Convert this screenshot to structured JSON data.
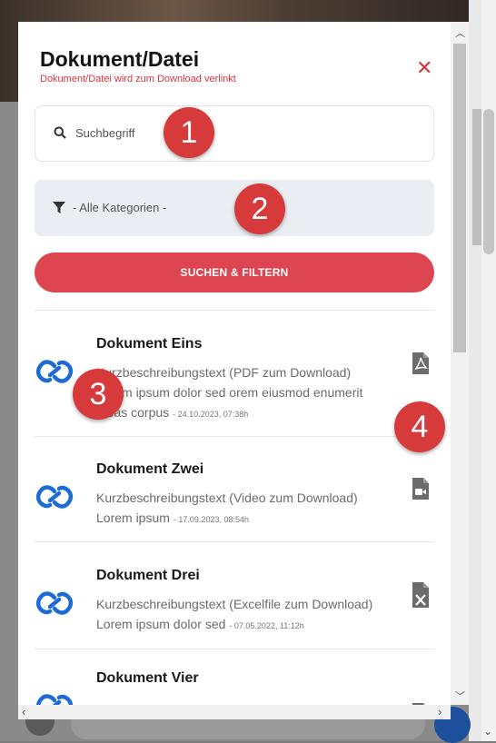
{
  "dialog": {
    "title": "Dokument/Datei",
    "subtitle": "Dokument/Datei wird zum Download verlinkt",
    "close_glyph": "✕"
  },
  "search": {
    "placeholder": "Suchbegriff",
    "icon": "search-icon"
  },
  "filter": {
    "label": "- Alle Kategorien -",
    "icon": "filter-icon"
  },
  "submit": {
    "label": "SUCHEN & FILTERN"
  },
  "colors": {
    "accent": "#dd4551",
    "link": "#1f6bd6",
    "badge": "#d73a3a",
    "filter_bg": "#eaedf2"
  },
  "items": [
    {
      "name": "Dokument Eins",
      "desc": "Kurzbeschreibungstext (PDF zum Download)",
      "desc2": "Lorem ipsum dolor sed orem eiusmod enumerit",
      "meta_text": "Ideas corpus",
      "date": "- 24.10.2023, 07:38h",
      "file_icon": "pdf-file-icon"
    },
    {
      "name": "Dokument Zwei",
      "desc": "Kurzbeschreibungstext (Video zum Download)",
      "meta_text": "Lorem ipsum",
      "date": "- 17.09.2023, 08:54h",
      "file_icon": "video-file-icon"
    },
    {
      "name": "Dokument Drei",
      "desc": "Kurzbeschreibungstext (Excelfile zum Download)",
      "meta_text": "Lorem ipsum dolor sed",
      "date": "- 07.05.2022, 11:12h",
      "file_icon": "excel-file-icon"
    },
    {
      "name": "Dokument Vier",
      "file_icon": "word-file-icon"
    }
  ],
  "badges": [
    "1",
    "2",
    "3",
    "4"
  ]
}
